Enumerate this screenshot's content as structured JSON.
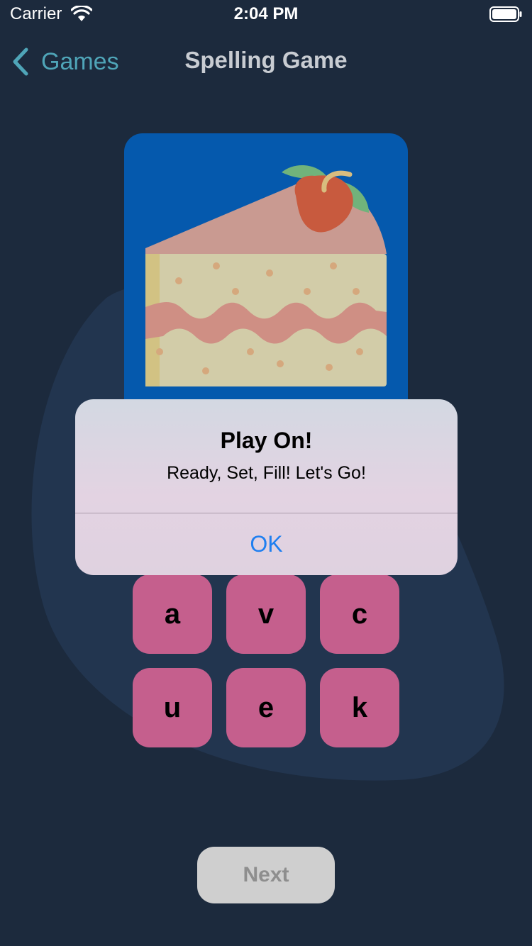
{
  "status_bar": {
    "carrier": "Carrier",
    "time": "2:04 PM",
    "wifi_icon": "wifi-icon",
    "battery_icon": "battery-icon"
  },
  "nav": {
    "back_label": "Games",
    "back_icon": "chevron-left-icon",
    "title": "Spelling Game"
  },
  "card": {
    "image": "cake-slice-illustration",
    "background_color": "#0559ad"
  },
  "letters": [
    "a",
    "v",
    "c",
    "u",
    "e",
    "k"
  ],
  "next_button": {
    "label": "Next",
    "enabled": false
  },
  "alert": {
    "title": "Play On!",
    "message": "Ready, Set, Fill! Let's Go!",
    "ok_label": "OK"
  },
  "colors": {
    "background": "#1c2a3d",
    "tile": "#c55f8d",
    "accent": "#4fa5b8",
    "alert_button": "#1f7ff0"
  }
}
